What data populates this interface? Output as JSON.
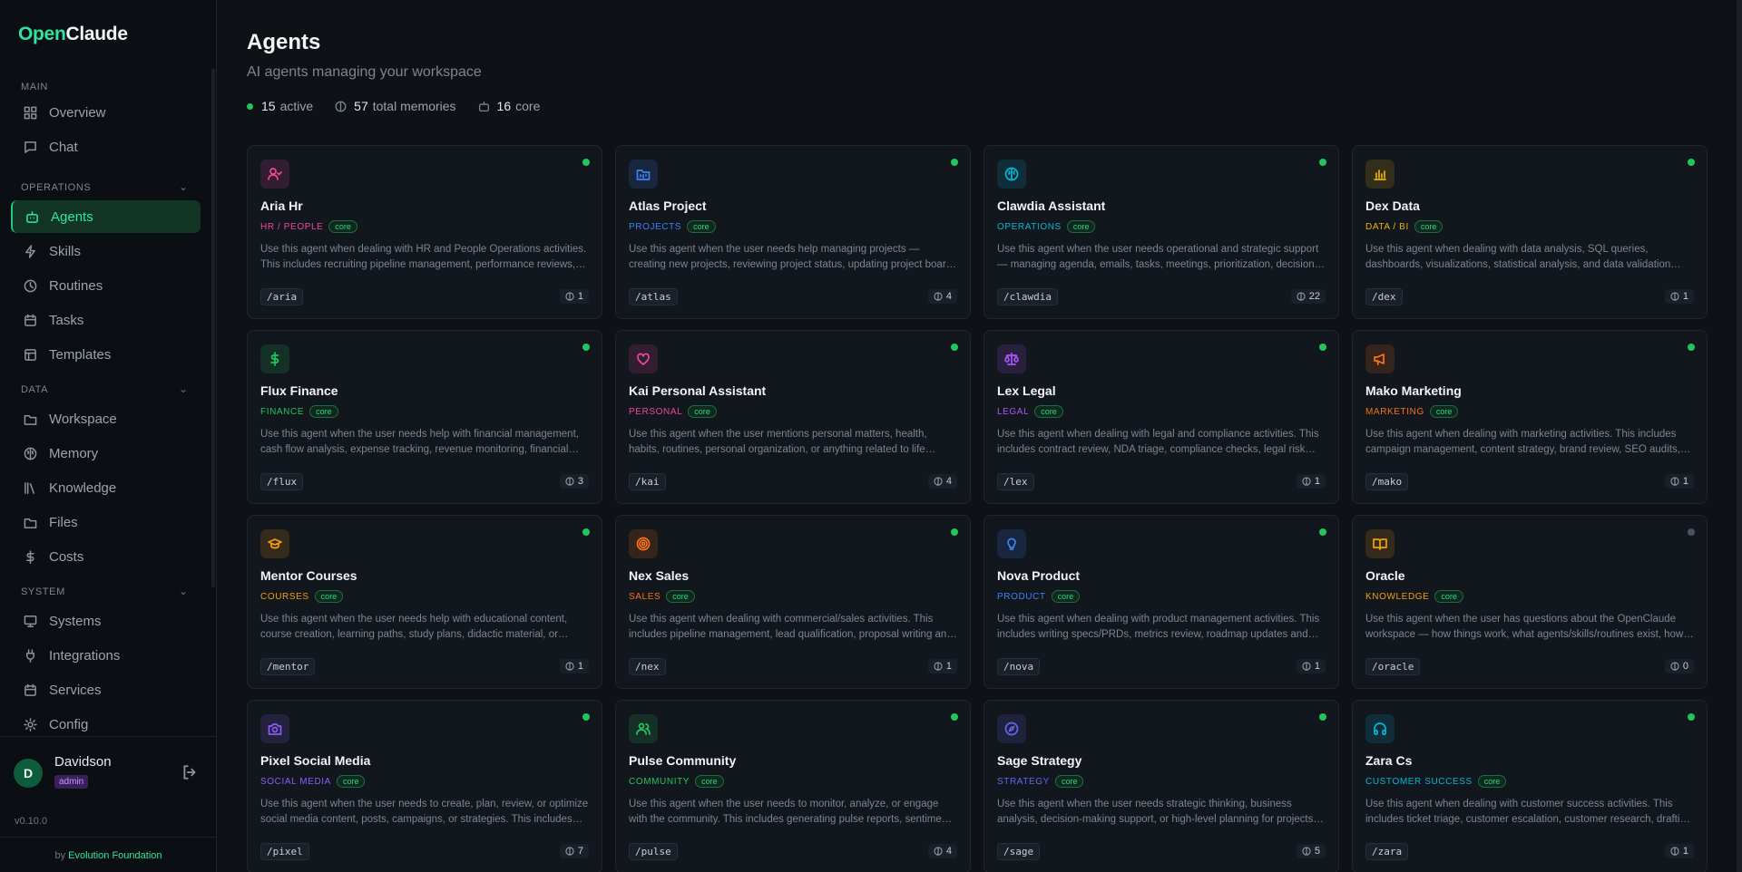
{
  "brand": {
    "part1": "Open",
    "part2": "Claude"
  },
  "sidebar": {
    "sections": {
      "main": "MAIN",
      "operations": "OPERATIONS",
      "data": "DATA",
      "system": "SYSTEM"
    },
    "items": [
      {
        "label": "Overview",
        "icon": "grid-icon"
      },
      {
        "label": "Chat",
        "icon": "chat-icon"
      },
      {
        "label": "Agents",
        "icon": "bot-icon",
        "active": true
      },
      {
        "label": "Skills",
        "icon": "zap-icon"
      },
      {
        "label": "Routines",
        "icon": "clock-icon"
      },
      {
        "label": "Tasks",
        "icon": "calendar-icon"
      },
      {
        "label": "Templates",
        "icon": "template-icon"
      },
      {
        "label": "Workspace",
        "icon": "folder-icon"
      },
      {
        "label": "Memory",
        "icon": "brain-icon"
      },
      {
        "label": "Knowledge",
        "icon": "library-icon"
      },
      {
        "label": "Files",
        "icon": "folder-icon"
      },
      {
        "label": "Costs",
        "icon": "dollar-icon"
      },
      {
        "label": "Systems",
        "icon": "monitor-icon"
      },
      {
        "label": "Integrations",
        "icon": "plug-icon"
      },
      {
        "label": "Services",
        "icon": "calendar-icon"
      },
      {
        "label": "Config",
        "icon": "gear-icon"
      }
    ]
  },
  "user": {
    "initial": "D",
    "name": "Davidson",
    "role": "admin"
  },
  "version": "v0.10.0",
  "footer": {
    "prefix": "by",
    "org": "Evolution Foundation"
  },
  "page": {
    "title": "Agents",
    "subtitle": "AI agents managing your workspace"
  },
  "stats": {
    "active_count": "15",
    "active_label": "active",
    "memories_count": "57",
    "memories_label": "total memories",
    "core_count": "16",
    "core_label": "core"
  },
  "core_tag": "core",
  "agents": [
    {
      "name": "Aria Hr",
      "category": "HR / PEOPLE",
      "color": "#ec4899",
      "icon": "user-check-icon",
      "desc": "Use this agent when dealing with HR and People Operations activities. This includes recruiting pipeline management, performance reviews, onboarding and people processes.",
      "command": "/aria",
      "memories": "1",
      "online": true
    },
    {
      "name": "Atlas Project",
      "category": "PROJECTS",
      "color": "#3b82f6",
      "icon": "folder-kanban-icon",
      "desc": "Use this agent when the user needs help managing projects — creating new projects, reviewing project status, updating project boards and milestones.",
      "command": "/atlas",
      "memories": "4",
      "online": true
    },
    {
      "name": "Clawdia Assistant",
      "category": "OPERATIONS",
      "color": "#06b6d4",
      "icon": "brain-icon",
      "desc": "Use this agent when the user needs operational and strategic support — managing agenda, emails, tasks, meetings, prioritization, decision making.",
      "command": "/clawdia",
      "memories": "22",
      "online": true
    },
    {
      "name": "Dex Data",
      "category": "DATA / BI",
      "color": "#eab308",
      "icon": "bar-chart-icon",
      "desc": "Use this agent when dealing with data analysis, SQL queries, dashboards, visualizations, statistical analysis, and data validation tasks.",
      "command": "/dex",
      "memories": "1",
      "online": true
    },
    {
      "name": "Flux Finance",
      "category": "FINANCE",
      "color": "#22c55e",
      "icon": "dollar-icon",
      "desc": "Use this agent when the user needs help with financial management, cash flow analysis, expense tracking, revenue monitoring, financial planning.",
      "command": "/flux",
      "memories": "3",
      "online": true
    },
    {
      "name": "Kai Personal Assistant",
      "category": "PERSONAL",
      "color": "#ec4899",
      "icon": "heart-icon",
      "desc": "Use this agent when the user mentions personal matters, health, habits, routines, personal organization, or anything related to life management.",
      "command": "/kai",
      "memories": "4",
      "online": true
    },
    {
      "name": "Lex Legal",
      "category": "LEGAL",
      "color": "#a855f7",
      "icon": "scale-icon",
      "desc": "Use this agent when dealing with legal and compliance activities. This includes contract review, NDA triage, compliance checks, legal risk assessment.",
      "command": "/lex",
      "memories": "1",
      "online": true
    },
    {
      "name": "Mako Marketing",
      "category": "MARKETING",
      "color": "#f97316",
      "icon": "megaphone-icon",
      "desc": "Use this agent when dealing with marketing activities. This includes campaign management, content strategy, brand review, SEO audits, and more.",
      "command": "/mako",
      "memories": "1",
      "online": true
    },
    {
      "name": "Mentor Courses",
      "category": "COURSES",
      "color": "#f59e0b",
      "icon": "graduation-cap-icon",
      "desc": "Use this agent when the user needs help with educational content, course creation, learning paths, study plans, didactic material, or training.",
      "command": "/mentor",
      "memories": "1",
      "online": true
    },
    {
      "name": "Nex Sales",
      "category": "SALES",
      "color": "#f97316",
      "icon": "target-icon",
      "desc": "Use this agent when dealing with commercial/sales activities. This includes pipeline management, lead qualification, proposal writing and follow-ups.",
      "command": "/nex",
      "memories": "1",
      "online": true
    },
    {
      "name": "Nova Product",
      "category": "PRODUCT",
      "color": "#3b82f6",
      "icon": "lightbulb-icon",
      "desc": "Use this agent when dealing with product management activities. This includes writing specs/PRDs, metrics review, roadmap updates and more.",
      "command": "/nova",
      "memories": "1",
      "online": true
    },
    {
      "name": "Oracle",
      "category": "KNOWLEDGE",
      "color": "#f59e0b",
      "icon": "book-open-icon",
      "desc": "Use this agent when the user has questions about the OpenClaude workspace — how things work, what agents/skills/routines exist, how to use them.",
      "command": "/oracle",
      "memories": "0",
      "online": false
    },
    {
      "name": "Pixel Social Media",
      "category": "SOCIAL MEDIA",
      "color": "#8b5cf6",
      "icon": "camera-icon",
      "desc": "Use this agent when the user needs to create, plan, review, or optimize social media content, posts, campaigns, or strategies. This includes scheduling.",
      "command": "/pixel",
      "memories": "7",
      "online": true
    },
    {
      "name": "Pulse Community",
      "category": "COMMUNITY",
      "color": "#22c55e",
      "icon": "users-icon",
      "desc": "Use this agent when the user needs to monitor, analyze, or engage with the community. This includes generating pulse reports, sentiment tracking.",
      "command": "/pulse",
      "memories": "4",
      "online": true
    },
    {
      "name": "Sage Strategy",
      "category": "STRATEGY",
      "color": "#6366f1",
      "icon": "compass-icon",
      "desc": "Use this agent when the user needs strategic thinking, business analysis, decision-making support, or high-level planning for projects and growth.",
      "command": "/sage",
      "memories": "5",
      "online": true
    },
    {
      "name": "Zara Cs",
      "category": "CUSTOMER SUCCESS",
      "color": "#06b6d4",
      "icon": "headphones-icon",
      "desc": "Use this agent when dealing with customer success activities. This includes ticket triage, customer escalation, customer research, drafting replies.",
      "command": "/zara",
      "memories": "1",
      "online": true
    }
  ]
}
